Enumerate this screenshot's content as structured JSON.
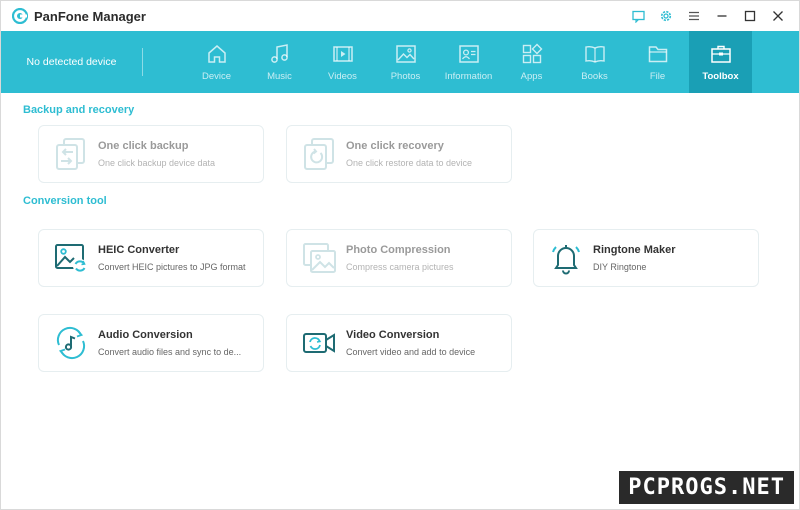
{
  "app": {
    "title": "PanFone Manager"
  },
  "titlebar": {
    "controls": [
      "feedback-icon",
      "settings-icon",
      "menu-icon",
      "minimize-icon",
      "maximize-icon",
      "close-icon"
    ]
  },
  "navbar": {
    "device_status": "No detected device",
    "tabs": [
      {
        "label": "Device",
        "icon": "home-icon"
      },
      {
        "label": "Music",
        "icon": "music-icon"
      },
      {
        "label": "Videos",
        "icon": "video-icon"
      },
      {
        "label": "Photos",
        "icon": "photo-icon"
      },
      {
        "label": "Information",
        "icon": "contact-card-icon"
      },
      {
        "label": "Apps",
        "icon": "apps-icon"
      },
      {
        "label": "Books",
        "icon": "book-icon"
      },
      {
        "label": "File",
        "icon": "folder-icon"
      },
      {
        "label": "Toolbox",
        "icon": "toolbox-icon",
        "active": true
      }
    ]
  },
  "sections": {
    "backup": {
      "title": "Backup and recovery",
      "cards": [
        {
          "title": "One click backup",
          "subtitle": "One click backup device data",
          "icon": "backup-icon",
          "disabled": true
        },
        {
          "title": "One click recovery",
          "subtitle": "One click restore data to device",
          "icon": "recovery-icon",
          "disabled": true
        }
      ]
    },
    "conversion": {
      "title": "Conversion tool",
      "cards": [
        {
          "title": "HEIC Converter",
          "subtitle": "Convert HEIC pictures to JPG format",
          "icon": "heic-converter-icon",
          "disabled": false
        },
        {
          "title": "Photo Compression",
          "subtitle": "Compress camera pictures",
          "icon": "photo-compression-icon",
          "disabled": true
        },
        {
          "title": "Ringtone Maker",
          "subtitle": "DIY Ringtone",
          "icon": "bell-icon",
          "disabled": false
        },
        {
          "title": "Audio Conversion",
          "subtitle": "Convert audio files and sync to de...",
          "icon": "audio-conversion-icon",
          "disabled": false
        },
        {
          "title": "Video Conversion",
          "subtitle": "Convert video and add to device",
          "icon": "video-conversion-icon",
          "disabled": false
        }
      ]
    }
  },
  "colors": {
    "accent": "#2ebdd2",
    "active_tab": "#1a9fb5",
    "icon_dark": "#1e6b73",
    "disabled": "#cfe3e6"
  },
  "watermark": "PCPROGS.NET"
}
